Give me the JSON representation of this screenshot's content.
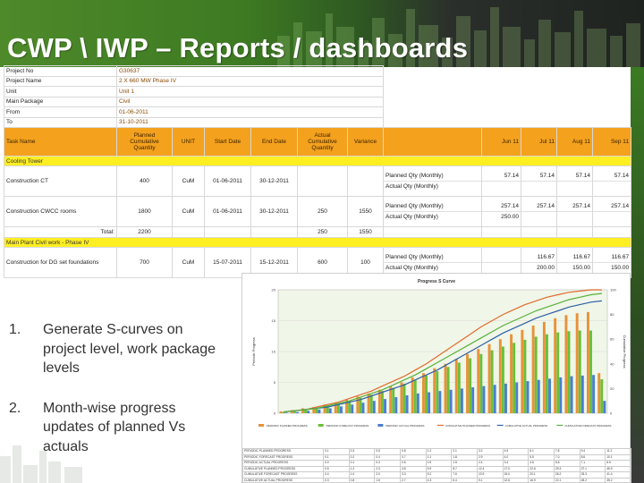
{
  "slide": {
    "title": "CWP \\ IWP  – Reports / dashboards"
  },
  "project_info": [
    {
      "label": "Project No",
      "value": "G30637"
    },
    {
      "label": "Project Name",
      "value": "2 X 660 MW Phase IV"
    },
    {
      "label": "Unit",
      "value": "Unit 1"
    },
    {
      "label": "Main Package",
      "value": "Civil"
    },
    {
      "label": "From",
      "value": "01-06-2011"
    },
    {
      "label": "To",
      "value": "31-10-2011"
    }
  ],
  "table": {
    "headers": [
      "Task Name",
      "Planned Cumulative Quantity",
      "UNIT",
      "Start Date",
      "End Date",
      "Actual Cumulative Quantity",
      "Variance",
      "",
      "Jun 11",
      "Jul 11",
      "Aug 11",
      "Sep 11"
    ],
    "sections": [
      {
        "name": "Cooling Tower",
        "rows": [
          {
            "task": "Construction CT",
            "planned": "400",
            "unit": "CuM",
            "start": "01-06-2011",
            "end": "30-12-2011",
            "actual": "",
            "variance": "",
            "lines": [
              {
                "label": "Planned Qty (Monthly)",
                "months": [
                  "57.14",
                  "57.14",
                  "57.14",
                  "57.14"
                ]
              },
              {
                "label": "Actual Qty (Monthly)",
                "months": [
                  "",
                  "",
                  "",
                  ""
                ]
              }
            ]
          },
          {
            "task": "Construction CWCC rooms",
            "planned": "1800",
            "unit": "CuM",
            "start": "01-06-2011",
            "end": "30-12-2011",
            "actual": "250",
            "variance": "1550",
            "lines": [
              {
                "label": "Planned Qty (Monthly)",
                "months": [
                  "257.14",
                  "257.14",
                  "257.14",
                  "257.14"
                ]
              },
              {
                "label": "Actual Qty (Monthly)",
                "months": [
                  "250.00",
                  "",
                  "",
                  ""
                ]
              }
            ]
          }
        ],
        "total": {
          "label": "Total:",
          "planned": "2200",
          "actual": "250",
          "variance": "1550"
        }
      },
      {
        "name": "Main Plant Civil work - Phase IV",
        "rows": [
          {
            "task": "Construction for DG set foundations",
            "planned": "700",
            "unit": "CuM",
            "start": "15-07-2011",
            "end": "15-12-2011",
            "actual": "600",
            "variance": "100",
            "lines": [
              {
                "label": "Planned Qty (Monthly)",
                "months": [
                  "",
                  "116.67",
                  "116.67",
                  "116.67"
                ]
              },
              {
                "label": "Actual Qty (Monthly)",
                "months": [
                  "",
                  "200.00",
                  "150.00",
                  "150.00"
                ]
              }
            ]
          }
        ]
      }
    ]
  },
  "bullets": [
    {
      "num": "1.",
      "text": "Generate S-curves on project level, work package levels"
    },
    {
      "num": "2.",
      "text": "Month-wise progress updates of planned Vs actuals"
    }
  ],
  "chart_data": {
    "type": "bar",
    "title": "Progress S Curve",
    "ylabel": "Periodic Progress",
    "ylabel_right": "Cumulative Progress",
    "ylim": [
      0,
      20
    ],
    "ylim_right": [
      0,
      100
    ],
    "yticks": [
      "0",
      "5",
      "10",
      "15",
      "20"
    ],
    "yticks_right": [
      "0",
      "20",
      "40",
      "60",
      "80",
      "100"
    ],
    "legend_position": "bottom",
    "series": [
      {
        "name": "PERIODIC PLANNED PROGRESS",
        "kind": "bar",
        "color": "#e8923a",
        "values": [
          0.3,
          0.5,
          0.8,
          1.0,
          1.4,
          1.7,
          2.2,
          2.7,
          3.2,
          3.8,
          4.4,
          5.0,
          5.8,
          6.5,
          7.3,
          8.0,
          8.8,
          9.6,
          10.4,
          11.2,
          12.0,
          12.8,
          13.5,
          14.2,
          14.8,
          15.4,
          15.9,
          16.2,
          16.4,
          6.5
        ]
      },
      {
        "name": "PERIODIC FORECAST PROGRESS",
        "kind": "bar",
        "color": "#6bbf3a",
        "values": [
          0.2,
          0.4,
          0.6,
          0.9,
          1.2,
          1.6,
          2.0,
          2.5,
          3.0,
          3.6,
          4.1,
          4.8,
          5.4,
          6.1,
          6.8,
          7.5,
          8.2,
          8.9,
          9.6,
          10.2,
          10.8,
          11.4,
          11.9,
          12.4,
          12.8,
          13.1,
          13.3,
          13.4,
          13.4,
          5.5
        ]
      },
      {
        "name": "PERIODIC ACTUAL PROGRESS",
        "kind": "bar",
        "color": "#4a7fd0",
        "values": [
          0.1,
          0.2,
          0.4,
          0.6,
          0.8,
          1.1,
          1.4,
          1.7,
          2.0,
          2.3,
          2.6,
          2.9,
          3.2,
          3.4,
          3.6,
          3.8,
          4.0,
          4.2,
          4.4,
          4.6,
          4.8,
          5.0,
          5.2,
          5.4,
          5.6,
          5.8,
          6.0,
          6.1,
          6.2,
          2.0
        ]
      },
      {
        "name": "CUMULATIVE PLANNED PROGRESS",
        "kind": "line",
        "axis": "right",
        "color": "#e06b2c",
        "values": [
          1,
          2,
          3,
          5,
          7,
          9,
          12,
          15,
          18,
          22,
          26,
          30,
          35,
          40,
          46,
          52,
          58,
          64,
          70,
          75,
          80,
          84,
          88,
          91,
          94,
          96,
          98,
          99,
          100,
          100
        ]
      },
      {
        "name": "CUMULATIVE ACTUAL PROGRESS",
        "kind": "line",
        "axis": "right",
        "color": "#2e5fa8",
        "values": [
          1,
          2,
          3,
          4,
          5,
          7,
          9,
          11,
          14,
          17,
          20,
          23,
          27,
          31,
          35,
          40,
          45,
          50,
          55,
          60,
          65,
          69,
          73,
          77,
          80,
          83,
          86,
          88,
          90,
          91
        ]
      },
      {
        "name": "CUMULATIVE FORECAST PROGRESS",
        "kind": "line",
        "axis": "right",
        "color": "#58b03a",
        "values": [
          1,
          2,
          3,
          4,
          6,
          8,
          10,
          13,
          16,
          19,
          23,
          27,
          31,
          36,
          41,
          46,
          51,
          56,
          61,
          66,
          71,
          75,
          79,
          83,
          86,
          89,
          92,
          94,
          96,
          97
        ]
      }
    ]
  },
  "bottom_table": {
    "rows": [
      [
        "PERIODIC PLANNED PROGRESS",
        "0.1",
        "0.3",
        "0.5",
        "0.8",
        "1.2",
        "2.1",
        "3.2",
        "4.5",
        "6.1",
        "7.8",
        "9.4",
        "11.2"
      ],
      [
        "PERIODIC FORECAST PROGRESS",
        "0.1",
        "0.2",
        "0.4",
        "0.7",
        "1.1",
        "1.8",
        "2.9",
        "4.0",
        "5.5",
        "7.0",
        "8.6",
        "10.1"
      ],
      [
        "PERIODIC ACTUAL PROGRESS",
        "0.0",
        "0.1",
        "0.3",
        "0.5",
        "0.9",
        "1.5",
        "2.4",
        "3.4",
        "4.6",
        "5.8",
        "7.1",
        "8.5"
      ],
      [
        "CUMULATIVE PLANNED PROGRESS",
        "0.5",
        "1.2",
        "2.3",
        "3.8",
        "5.9",
        "8.7",
        "12.4",
        "17.0",
        "22.6",
        "29.3",
        "37.1",
        "45.9"
      ],
      [
        "CUMULATIVE FORECAST PROGRESS",
        "0.4",
        "1.0",
        "2.0",
        "3.3",
        "5.2",
        "7.6",
        "10.9",
        "15.0",
        "20.1",
        "26.2",
        "33.3",
        "41.4"
      ],
      [
        "CUMULATIVE ACTUAL PROGRESS",
        "0.3",
        "0.8",
        "1.6",
        "2.7",
        "4.3",
        "6.4",
        "9.1",
        "12.6",
        "16.9",
        "22.1",
        "28.2",
        "35.2"
      ]
    ]
  }
}
